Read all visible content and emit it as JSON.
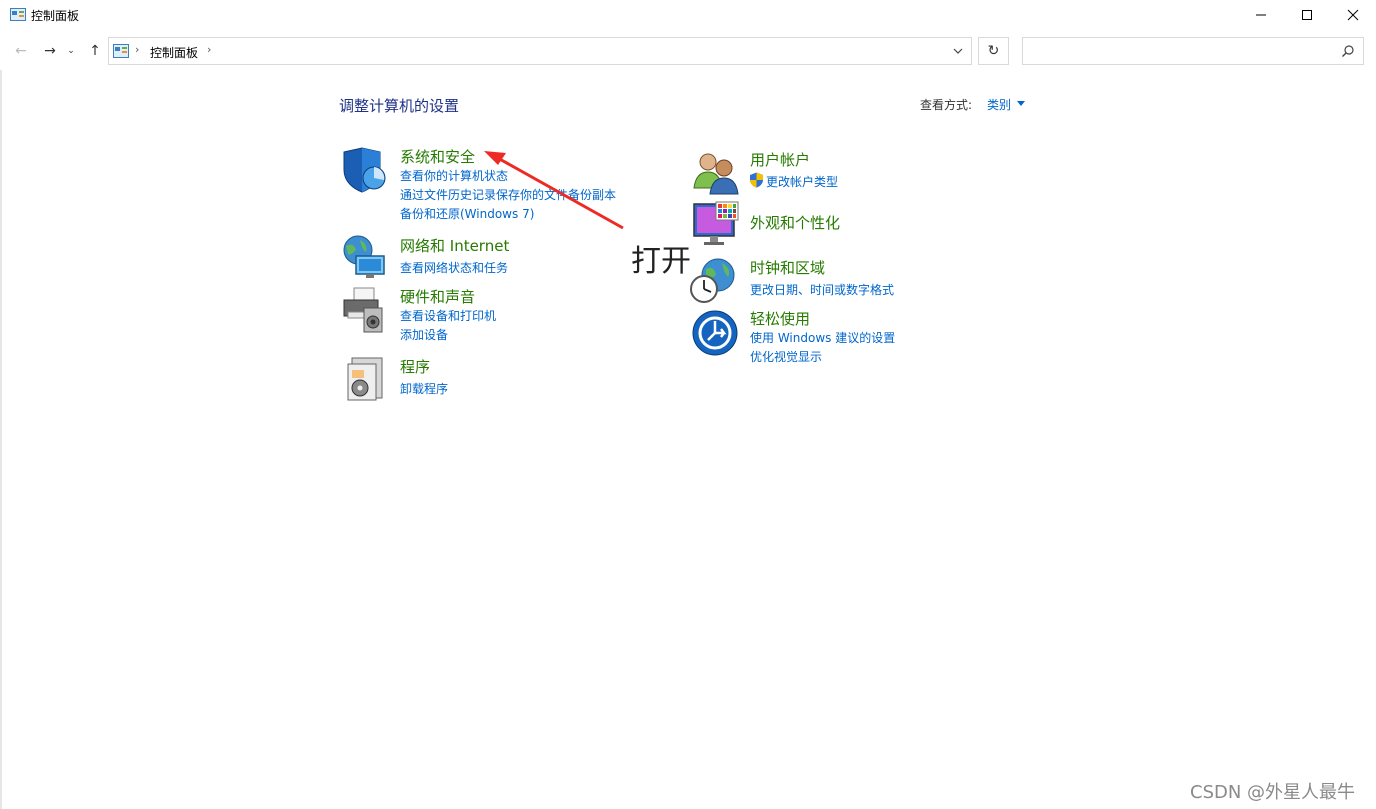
{
  "window": {
    "title": "控制面板"
  },
  "address": {
    "crumb": "控制面板"
  },
  "search": {
    "placeholder": ""
  },
  "main": {
    "heading": "调整计算机的设置",
    "view_by_label": "查看方式:",
    "view_by_value": "类别"
  },
  "categories": {
    "system_security": {
      "title": "系统和安全",
      "links": [
        "查看你的计算机状态",
        "通过文件历史记录保存你的文件备份副本",
        "备份和还原(Windows 7)"
      ]
    },
    "network": {
      "title": "网络和 Internet",
      "links": [
        "查看网络状态和任务"
      ]
    },
    "hardware": {
      "title": "硬件和声音",
      "links": [
        "查看设备和打印机",
        "添加设备"
      ]
    },
    "programs": {
      "title": "程序",
      "links": [
        "卸载程序"
      ]
    },
    "user_accounts": {
      "title": "用户帐户",
      "links": [
        "更改帐户类型"
      ]
    },
    "appearance": {
      "title": "外观和个性化",
      "links": []
    },
    "clock_region": {
      "title": "时钟和区域",
      "links": [
        "更改日期、时间或数字格式"
      ]
    },
    "ease_access": {
      "title": "轻松使用",
      "links": [
        "使用 Windows 建议的设置",
        "优化视觉显示"
      ]
    }
  },
  "annotation": {
    "text": "打开",
    "arrow_color": "#ee2a24"
  },
  "watermark": "CSDN @外星人最牛",
  "colors": {
    "category_title": "#267b00",
    "link": "#0066cc",
    "heading": "#1e3287"
  }
}
